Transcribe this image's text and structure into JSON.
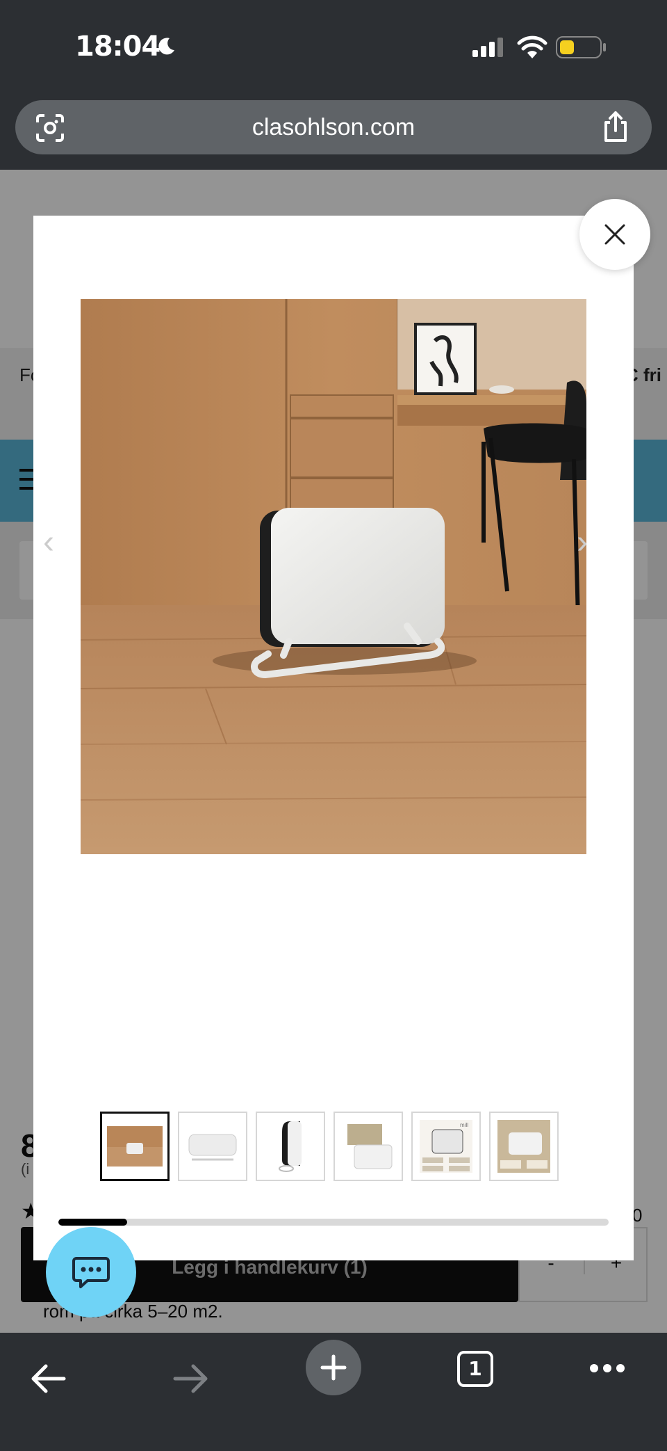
{
  "status_bar": {
    "time": "18:04"
  },
  "browser": {
    "url": "clasohlson.com",
    "tab_count": "1"
  },
  "background_page": {
    "nav_left_text": "Fo",
    "nav_right_text": "C fri",
    "price_partial": "8",
    "price_sub_partial": "(i",
    "rating_count_partial": "0",
    "add_to_cart_label": "Legg i handlekurv (1)",
    "qty_minus": "-",
    "qty_plus": "+",
    "description_partial": "rom på cirka 5–20 m2."
  },
  "gallery": {
    "thumbnail_count": 6,
    "active_index": 0,
    "progress_fraction": 0.125,
    "thumb_text_mill": "mill"
  },
  "colors": {
    "chat_button": "#6fd3f6",
    "header_blue": "#5bb7d9",
    "toolbar": "#2c2f33"
  },
  "icons": [
    "camera-lens-icon",
    "share-icon",
    "close-icon",
    "chat-icon",
    "back-arrow-icon",
    "forward-arrow-icon",
    "plus-icon",
    "tabs-icon",
    "more-icon"
  ]
}
